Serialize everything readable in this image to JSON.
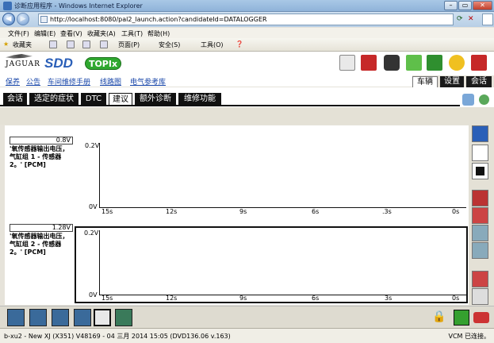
{
  "window": {
    "title": "诊断应用程序 - Windows Internet Explorer",
    "min": "–",
    "max": "▭",
    "close": "✕"
  },
  "browser": {
    "url": "http://localhost:8080/pal2_launch.action?candidateId=DATALOGGER",
    "menu": [
      "文件(F)",
      "编辑(E)",
      "查看(V)",
      "收藏夹(A)",
      "工具(T)",
      "帮助(H)"
    ],
    "favorites": "收藏夹",
    "commands": [
      "页面(P)",
      "安全(S)",
      "工具(O)"
    ]
  },
  "header": {
    "brand": "JAGUAR",
    "sdd": "SDD",
    "topix": "TOPIx"
  },
  "nav_links": [
    "保养",
    "公告",
    "车间维修手册",
    "线路图",
    "电气参考库"
  ],
  "right_tabs": [
    "车辆",
    "设置",
    "会话"
  ],
  "tabs": [
    "会话",
    "选定的症状",
    "DTC",
    "建议",
    "额外诊断",
    "维修功能"
  ],
  "active_tab": "建议",
  "charts_text": {
    "chart1": {
      "value": "0.8V",
      "signal": "'氧传感器输出电压，气缸组 1 - 传感器 2。' [PCM]"
    },
    "chart2": {
      "value": "1.28V",
      "signal": "'氧传感器输出电压，气缸组 2 - 传感器 2。' [PCM]"
    }
  },
  "chart_data": [
    {
      "type": "line",
      "title": "",
      "series": [
        {
          "name": "'氧传感器输出电压，气缸组 1 - 传感器 2。' [PCM]",
          "values": []
        }
      ],
      "ylabel": "",
      "yticks": [
        "0.2V",
        "0V"
      ],
      "xticks": [
        "15s",
        "12s",
        "9s",
        "6s",
        ".3s",
        "0s"
      ],
      "ylim": [
        0,
        0.2
      ]
    },
    {
      "type": "line",
      "title": "",
      "series": [
        {
          "name": "'氧传感器输出电压，气缸组 2 - 传感器 2。' [PCM]",
          "values": []
        }
      ],
      "ylabel": "",
      "yticks": [
        "0.2V",
        "0V"
      ],
      "xticks": [
        "15s",
        "12s",
        "9s",
        "6s",
        "3s",
        "0s"
      ],
      "ylim": [
        0,
        0.2
      ]
    }
  ],
  "status": {
    "left": "b-xu2 - New XJ (X351) V48169 - 04 三月 2014 15:05 (DVD136.06 v.163)",
    "right": "VCM 已连接。"
  }
}
